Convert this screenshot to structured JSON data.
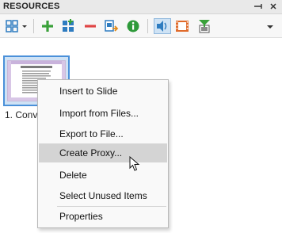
{
  "panel": {
    "title": "RESOURCES",
    "pin_icon": "pin-icon",
    "close_icon": "close-icon"
  },
  "toolbar": {
    "items": [
      {
        "name": "view-mode",
        "icon": "grid-view-icon"
      },
      {
        "name": "add",
        "icon": "plus-icon"
      },
      {
        "name": "add-items",
        "icon": "add-items-icon"
      },
      {
        "name": "remove",
        "icon": "minus-icon"
      },
      {
        "name": "export",
        "icon": "export-icon"
      },
      {
        "name": "info",
        "icon": "info-icon"
      },
      {
        "name": "audio-filter",
        "icon": "speaker-icon",
        "active": true
      },
      {
        "name": "video-filter",
        "icon": "film-icon"
      },
      {
        "name": "slide-filter",
        "icon": "funnel-icon"
      }
    ],
    "overflow_icon": "dropdown-icon"
  },
  "resource_item": {
    "label": "1. Conv"
  },
  "context_menu": {
    "items": [
      {
        "label": "Insert to Slide"
      },
      {
        "label": "Import from Files..."
      },
      {
        "label": "Export to File..."
      },
      {
        "label": "Create Proxy...",
        "hovered": true
      },
      {
        "label": "Delete"
      },
      {
        "label": "Select Unused Items"
      },
      {
        "label": "Properties"
      }
    ]
  },
  "colors": {
    "accent": "#4a90d9",
    "menu_hover": "#d4d4d4",
    "add_green": "#3aa13a",
    "remove_red": "#e04646",
    "info_green": "#2e9a3a",
    "film_orange": "#e06a2a"
  }
}
